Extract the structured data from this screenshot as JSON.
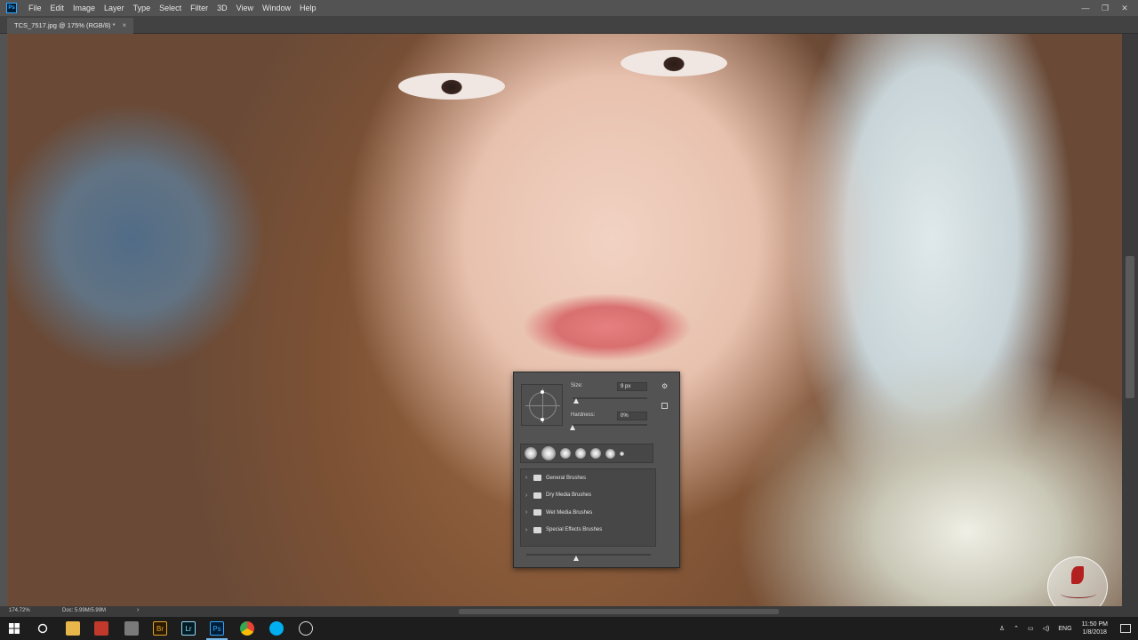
{
  "app": {
    "logo": "Ps"
  },
  "menu": [
    "File",
    "Edit",
    "Image",
    "Layer",
    "Type",
    "Select",
    "Filter",
    "3D",
    "View",
    "Window",
    "Help"
  ],
  "window_controls": {
    "minimize": "—",
    "restore": "❐",
    "close": "✕"
  },
  "document": {
    "tab_title": "TCS_7517.jpg @ 175% (RGB/8) *",
    "tab_close": "×"
  },
  "brush_panel": {
    "size_label": "Size:",
    "size_value": "9 px",
    "hardness_label": "Hardness:",
    "hardness_value": "0%",
    "size_slider": 0.05,
    "hardness_slider": 0.0,
    "preview_slider": 0.4,
    "folders": [
      "General Brushes",
      "Dry Media Brushes",
      "Wet Media Brushes",
      "Special Effects Brushes"
    ],
    "icons": {
      "settings": "gear-icon",
      "reset": "reset-icon",
      "folder": "folder-icon",
      "expand": "chevron-right-icon"
    }
  },
  "status": {
    "zoom": "174.72%",
    "doc": "Doc: 5.99M/5.99M",
    "arrow": "›"
  },
  "taskbar": {
    "apps": [
      "start",
      "search",
      "file-explorer",
      "puzzle-app",
      "disk-app",
      "bridge",
      "lightroom",
      "photoshop",
      "chrome",
      "skype",
      "settings-app"
    ],
    "bridge_label": "Br",
    "lightroom_label": "Lr",
    "photoshop_label": "Ps",
    "language": "ENG",
    "time": "11:50 PM",
    "date": "1/8/2018"
  },
  "colors": {
    "accent": "#31a8ff",
    "panel": "#535353",
    "taskbar": "#1d1d1d"
  }
}
